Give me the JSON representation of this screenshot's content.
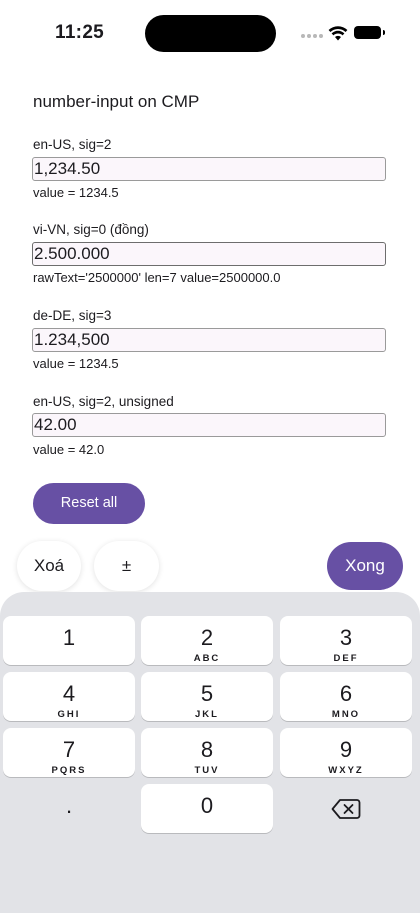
{
  "status": {
    "time": "11:25"
  },
  "title": "number-input on CMP",
  "sections": [
    {
      "label": "en-US, sig=2",
      "value": "1,234.50",
      "info": "value = 1234.5"
    },
    {
      "label": "vi-VN, sig=0 (đồng)",
      "value": "2.500.000",
      "info": "rawText='2500000' len=7 value=2500000.0"
    },
    {
      "label": "de-DE, sig=3",
      "value": "1.234,500",
      "info": "value = 1234.5"
    },
    {
      "label": "en-US, sig=2, unsigned",
      "value": "42.00",
      "info": "value = 42.0"
    }
  ],
  "reset_label": "Reset all",
  "accessory": {
    "clear": "Xoá",
    "sign": "±",
    "done": "Xong"
  },
  "keys": [
    {
      "digit": "1",
      "letters": ""
    },
    {
      "digit": "2",
      "letters": "ABC"
    },
    {
      "digit": "3",
      "letters": "DEF"
    },
    {
      "digit": "4",
      "letters": "GHI"
    },
    {
      "digit": "5",
      "letters": "JKL"
    },
    {
      "digit": "6",
      "letters": "MNO"
    },
    {
      "digit": "7",
      "letters": "PQRS"
    },
    {
      "digit": "8",
      "letters": "TUV"
    },
    {
      "digit": "9",
      "letters": "WXYZ"
    },
    {
      "digit": ".",
      "letters": ""
    },
    {
      "digit": "0",
      "letters": ""
    }
  ],
  "icons": {
    "backspace": "backspace-icon",
    "wifi": "wifi-icon",
    "battery": "battery-icon"
  }
}
